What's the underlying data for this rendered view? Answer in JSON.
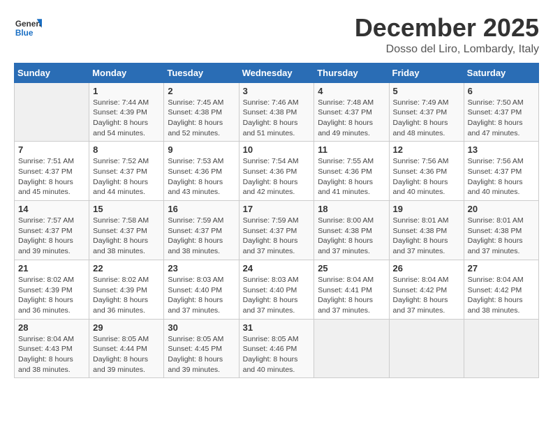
{
  "header": {
    "logo_general": "General",
    "logo_blue": "Blue",
    "month": "December 2025",
    "location": "Dosso del Liro, Lombardy, Italy"
  },
  "days_of_week": [
    "Sunday",
    "Monday",
    "Tuesday",
    "Wednesday",
    "Thursday",
    "Friday",
    "Saturday"
  ],
  "weeks": [
    [
      {
        "day": "",
        "info": ""
      },
      {
        "day": "1",
        "info": "Sunrise: 7:44 AM\nSunset: 4:39 PM\nDaylight: 8 hours\nand 54 minutes."
      },
      {
        "day": "2",
        "info": "Sunrise: 7:45 AM\nSunset: 4:38 PM\nDaylight: 8 hours\nand 52 minutes."
      },
      {
        "day": "3",
        "info": "Sunrise: 7:46 AM\nSunset: 4:38 PM\nDaylight: 8 hours\nand 51 minutes."
      },
      {
        "day": "4",
        "info": "Sunrise: 7:48 AM\nSunset: 4:37 PM\nDaylight: 8 hours\nand 49 minutes."
      },
      {
        "day": "5",
        "info": "Sunrise: 7:49 AM\nSunset: 4:37 PM\nDaylight: 8 hours\nand 48 minutes."
      },
      {
        "day": "6",
        "info": "Sunrise: 7:50 AM\nSunset: 4:37 PM\nDaylight: 8 hours\nand 47 minutes."
      }
    ],
    [
      {
        "day": "7",
        "info": "Sunrise: 7:51 AM\nSunset: 4:37 PM\nDaylight: 8 hours\nand 45 minutes."
      },
      {
        "day": "8",
        "info": "Sunrise: 7:52 AM\nSunset: 4:37 PM\nDaylight: 8 hours\nand 44 minutes."
      },
      {
        "day": "9",
        "info": "Sunrise: 7:53 AM\nSunset: 4:36 PM\nDaylight: 8 hours\nand 43 minutes."
      },
      {
        "day": "10",
        "info": "Sunrise: 7:54 AM\nSunset: 4:36 PM\nDaylight: 8 hours\nand 42 minutes."
      },
      {
        "day": "11",
        "info": "Sunrise: 7:55 AM\nSunset: 4:36 PM\nDaylight: 8 hours\nand 41 minutes."
      },
      {
        "day": "12",
        "info": "Sunrise: 7:56 AM\nSunset: 4:36 PM\nDaylight: 8 hours\nand 40 minutes."
      },
      {
        "day": "13",
        "info": "Sunrise: 7:56 AM\nSunset: 4:37 PM\nDaylight: 8 hours\nand 40 minutes."
      }
    ],
    [
      {
        "day": "14",
        "info": "Sunrise: 7:57 AM\nSunset: 4:37 PM\nDaylight: 8 hours\nand 39 minutes."
      },
      {
        "day": "15",
        "info": "Sunrise: 7:58 AM\nSunset: 4:37 PM\nDaylight: 8 hours\nand 38 minutes."
      },
      {
        "day": "16",
        "info": "Sunrise: 7:59 AM\nSunset: 4:37 PM\nDaylight: 8 hours\nand 38 minutes."
      },
      {
        "day": "17",
        "info": "Sunrise: 7:59 AM\nSunset: 4:37 PM\nDaylight: 8 hours\nand 37 minutes."
      },
      {
        "day": "18",
        "info": "Sunrise: 8:00 AM\nSunset: 4:38 PM\nDaylight: 8 hours\nand 37 minutes."
      },
      {
        "day": "19",
        "info": "Sunrise: 8:01 AM\nSunset: 4:38 PM\nDaylight: 8 hours\nand 37 minutes."
      },
      {
        "day": "20",
        "info": "Sunrise: 8:01 AM\nSunset: 4:38 PM\nDaylight: 8 hours\nand 37 minutes."
      }
    ],
    [
      {
        "day": "21",
        "info": "Sunrise: 8:02 AM\nSunset: 4:39 PM\nDaylight: 8 hours\nand 36 minutes."
      },
      {
        "day": "22",
        "info": "Sunrise: 8:02 AM\nSunset: 4:39 PM\nDaylight: 8 hours\nand 36 minutes."
      },
      {
        "day": "23",
        "info": "Sunrise: 8:03 AM\nSunset: 4:40 PM\nDaylight: 8 hours\nand 37 minutes."
      },
      {
        "day": "24",
        "info": "Sunrise: 8:03 AM\nSunset: 4:40 PM\nDaylight: 8 hours\nand 37 minutes."
      },
      {
        "day": "25",
        "info": "Sunrise: 8:04 AM\nSunset: 4:41 PM\nDaylight: 8 hours\nand 37 minutes."
      },
      {
        "day": "26",
        "info": "Sunrise: 8:04 AM\nSunset: 4:42 PM\nDaylight: 8 hours\nand 37 minutes."
      },
      {
        "day": "27",
        "info": "Sunrise: 8:04 AM\nSunset: 4:42 PM\nDaylight: 8 hours\nand 38 minutes."
      }
    ],
    [
      {
        "day": "28",
        "info": "Sunrise: 8:04 AM\nSunset: 4:43 PM\nDaylight: 8 hours\nand 38 minutes."
      },
      {
        "day": "29",
        "info": "Sunrise: 8:05 AM\nSunset: 4:44 PM\nDaylight: 8 hours\nand 39 minutes."
      },
      {
        "day": "30",
        "info": "Sunrise: 8:05 AM\nSunset: 4:45 PM\nDaylight: 8 hours\nand 39 minutes."
      },
      {
        "day": "31",
        "info": "Sunrise: 8:05 AM\nSunset: 4:46 PM\nDaylight: 8 hours\nand 40 minutes."
      },
      {
        "day": "",
        "info": ""
      },
      {
        "day": "",
        "info": ""
      },
      {
        "day": "",
        "info": ""
      }
    ]
  ]
}
